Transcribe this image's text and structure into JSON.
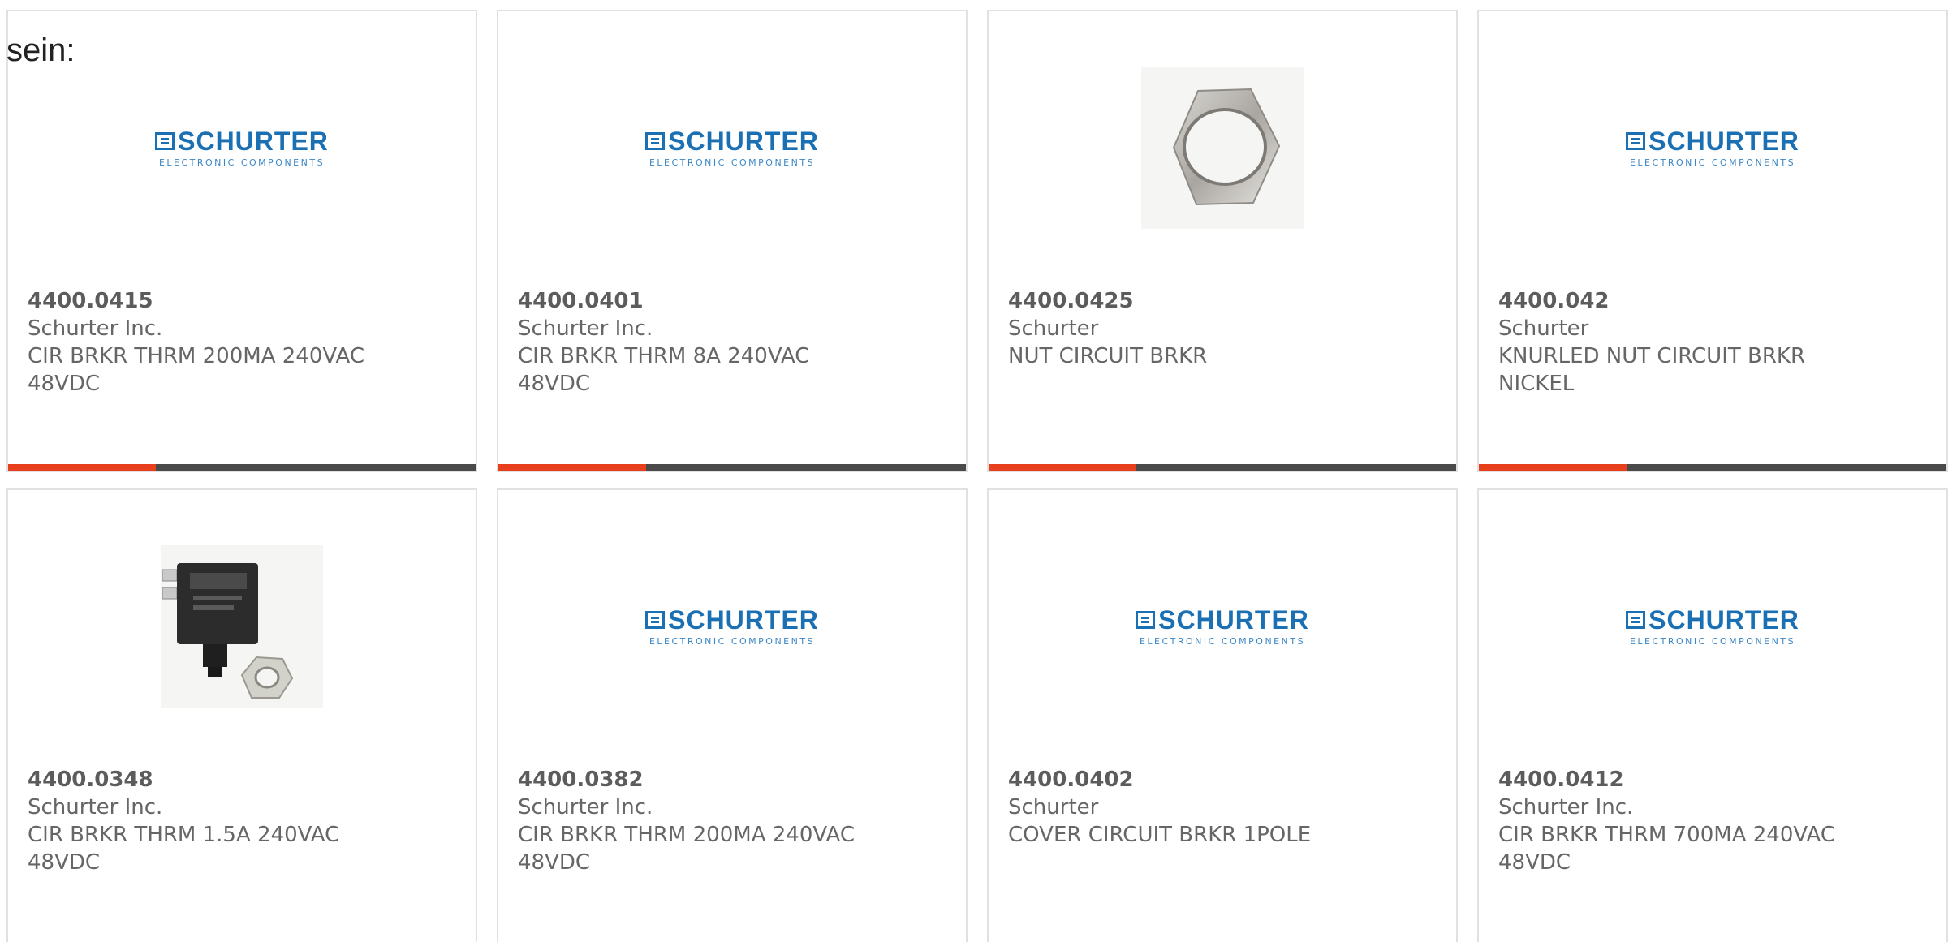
{
  "lead_text": "sein:",
  "logo": {
    "word": "SCHURTER",
    "sub": "ELECTRONIC COMPONENTS"
  },
  "colors": {
    "accent_bar": "#e8401c",
    "dark_bar": "#4a4a4a",
    "logo_blue": "#1b6fb3"
  },
  "products": [
    {
      "part_number": "4400.0415",
      "manufacturer": "Schurter Inc.",
      "desc_line1": "CIR BRKR THRM 200MA 240VAC",
      "desc_line2": "48VDC",
      "image": "schurter-logo"
    },
    {
      "part_number": "4400.0401",
      "manufacturer": "Schurter Inc.",
      "desc_line1": "CIR BRKR THRM 8A 240VAC",
      "desc_line2": "48VDC",
      "image": "schurter-logo"
    },
    {
      "part_number": "4400.0425",
      "manufacturer": "Schurter",
      "desc_line1": "NUT CIRCUIT BRKR",
      "desc_line2": "",
      "image": "hex-nut-photo"
    },
    {
      "part_number": "4400.042",
      "manufacturer": "Schurter",
      "desc_line1": "KNURLED NUT CIRCUIT BRKR",
      "desc_line2": "NICKEL",
      "image": "schurter-logo"
    },
    {
      "part_number": "4400.0348",
      "manufacturer": "Schurter Inc.",
      "desc_line1": "CIR BRKR THRM 1.5A 240VAC",
      "desc_line2": "48VDC",
      "image": "circuit-breaker-photo"
    },
    {
      "part_number": "4400.0382",
      "manufacturer": "Schurter Inc.",
      "desc_line1": "CIR BRKR THRM 200MA 240VAC",
      "desc_line2": "48VDC",
      "image": "schurter-logo"
    },
    {
      "part_number": "4400.0402",
      "manufacturer": "Schurter",
      "desc_line1": "COVER CIRCUIT BRKR 1POLE",
      "desc_line2": "",
      "image": "schurter-logo"
    },
    {
      "part_number": "4400.0412",
      "manufacturer": "Schurter Inc.",
      "desc_line1": "CIR BRKR THRM 700MA 240VAC",
      "desc_line2": "48VDC",
      "image": "schurter-logo"
    }
  ]
}
